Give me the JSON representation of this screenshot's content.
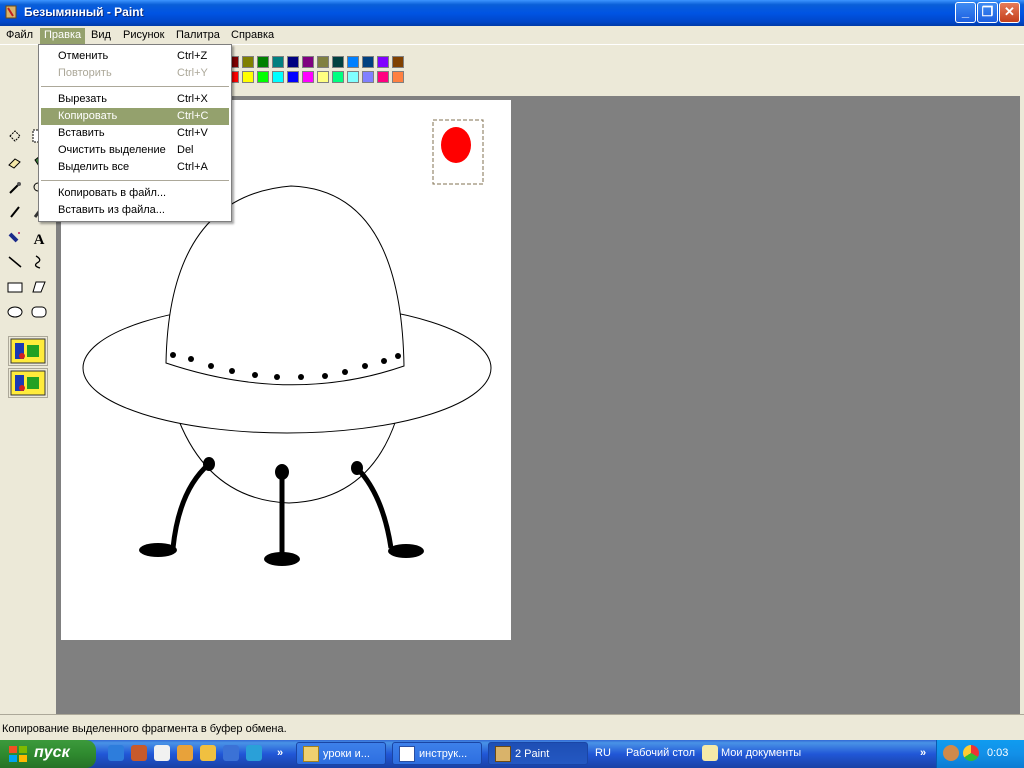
{
  "window": {
    "title": "Безымянный - Paint",
    "minimize_glyph": "_",
    "restore_glyph": "❐",
    "close_glyph": "✕"
  },
  "menubar": {
    "items": [
      "Файл",
      "Правка",
      "Вид",
      "Рисунок",
      "Палитра",
      "Справка"
    ],
    "active": "Правка"
  },
  "edit_menu": {
    "items": [
      {
        "label": "Отменить",
        "shortcut": "Ctrl+Z",
        "disabled": false
      },
      {
        "label": "Повторить",
        "shortcut": "Ctrl+Y",
        "disabled": true
      },
      {
        "label": "Вырезать",
        "shortcut": "Ctrl+X",
        "disabled": false
      },
      {
        "label": "Копировать",
        "shortcut": "Ctrl+C",
        "disabled": false,
        "highlighted": true
      },
      {
        "label": "Вставить",
        "shortcut": "Ctrl+V",
        "disabled": false
      },
      {
        "label": "Очистить выделение",
        "shortcut": "Del",
        "disabled": false
      },
      {
        "label": "Выделить все",
        "shortcut": "Ctrl+A",
        "disabled": false
      },
      {
        "label": "Копировать в файл...",
        "shortcut": "",
        "disabled": false
      },
      {
        "label": "Вставить из файла...",
        "shortcut": "",
        "disabled": false
      }
    ]
  },
  "palette": {
    "row1": [
      "#800000",
      "#808000",
      "#008000",
      "#008080",
      "#000080",
      "#800080",
      "#808040",
      "#004040",
      "#0080ff",
      "#004080",
      "#8000ff",
      "#804000"
    ],
    "row2": [
      "#ff0000",
      "#ffff00",
      "#00ff00",
      "#00ffff",
      "#0000ff",
      "#ff00ff",
      "#ffff80",
      "#00ff80",
      "#80ffff",
      "#8080ff",
      "#ff0080",
      "#ff8040"
    ]
  },
  "tools": {
    "text_tool_glyph": "A"
  },
  "canvas": {
    "selection_fill": "#ff0000",
    "drawing": "ufo-sketch"
  },
  "status": {
    "text": "Копирование выделенного фрагмента в буфер обмена."
  },
  "taskbar": {
    "start_label": "пуск",
    "buttons": [
      {
        "label": "уроки и...",
        "icon": "folder-icon"
      },
      {
        "label": "инструк...",
        "icon": "word-icon"
      },
      {
        "label": "2 Paint",
        "icon": "paint-icon",
        "active": true
      }
    ],
    "lang": "RU",
    "desktop_label": "Рабочий стол",
    "docs_label": "Мои документы",
    "clock": "0:03",
    "more_glyph": "»"
  }
}
